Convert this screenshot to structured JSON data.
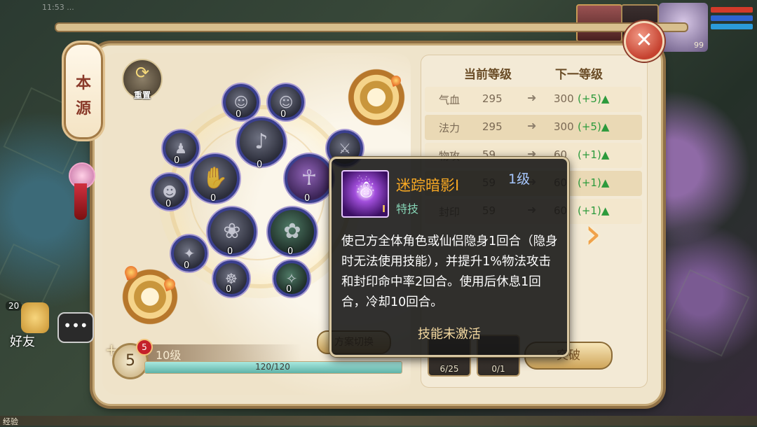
{
  "status_bar": {
    "text": "11:53 ..."
  },
  "hud": {
    "level": "99"
  },
  "colors": {
    "frame": "#efe4cb",
    "accent_gold": "#c5a876",
    "tooltip_title": "#f7a823",
    "stat_gain": "#2c9a3c",
    "close": "#c5412f"
  },
  "icons": {
    "reset": "refresh-arrows-icon",
    "close": "close-x-icon",
    "next": "chevron-right-icon",
    "skill": "meditating-figure-icon",
    "chat": "chat-bubble-icon",
    "friend": "friend-avatar-icon"
  },
  "lantern": {
    "line1": "本",
    "line2": "源"
  },
  "reset_button": {
    "label": "重置"
  },
  "close_button": {
    "glyph": "✕"
  },
  "skill_nodes": [
    {
      "count": "0",
      "glyph": "☺"
    },
    {
      "count": "0",
      "glyph": "☺"
    },
    {
      "count": "0",
      "glyph": "♪"
    },
    {
      "count": "0",
      "glyph": "♟"
    },
    {
      "count": "0",
      "glyph": "⚔"
    },
    {
      "count": "0",
      "glyph": "✋"
    },
    {
      "count": "0",
      "glyph": "☥"
    },
    {
      "count": "0",
      "glyph": "☻"
    },
    {
      "count": "0",
      "glyph": "❀"
    },
    {
      "count": "0",
      "glyph": "✿"
    },
    {
      "count": "0",
      "glyph": "✦"
    },
    {
      "count": "0",
      "glyph": "☸"
    },
    {
      "count": "0",
      "glyph": "✧"
    }
  ],
  "level_panel": {
    "points": "5",
    "badge": "5",
    "plus": "+",
    "level_label": "10级",
    "exp_text": "120/120",
    "exp_fraction": 1.0,
    "switch_label": "方案切换"
  },
  "stats": {
    "header_current": "当前等级",
    "header_next": "下一等级",
    "arrow": "➜",
    "rows": [
      {
        "name": "气血",
        "current": "295",
        "next": "300",
        "gain": "(+5)▲"
      },
      {
        "name": "法力",
        "current": "295",
        "next": "300",
        "gain": "(+5)▲"
      },
      {
        "name": "物攻",
        "current": "59",
        "next": "60",
        "gain": "(+1)▲"
      },
      {
        "name": "法攻",
        "current": "59",
        "next": "60",
        "gain": "(+1)▲"
      },
      {
        "name": "封印",
        "current": "59",
        "next": "60",
        "gain": "(+1)▲"
      }
    ]
  },
  "nav": {
    "next_glyph": "›"
  },
  "items": [
    {
      "count": "6/25"
    },
    {
      "count": "0/1"
    }
  ],
  "break_button": {
    "label": "突破"
  },
  "left_hud": {
    "friend_badge": "20",
    "friend_label": "好友",
    "chat_glyph": "•••"
  },
  "tooltip": {
    "name": "迷踪暗影I",
    "level": "1级",
    "type": "特技",
    "icon_tag": "I",
    "icon_figure": "☃",
    "description": "使己方全体角色或仙侣隐身1回合（隐身时无法使用技能），并提升1%物法攻击和封印命中率2回合。使用后休息1回合，冷却10回合。",
    "status": "技能未激活"
  },
  "corner": {
    "text": "经验"
  }
}
